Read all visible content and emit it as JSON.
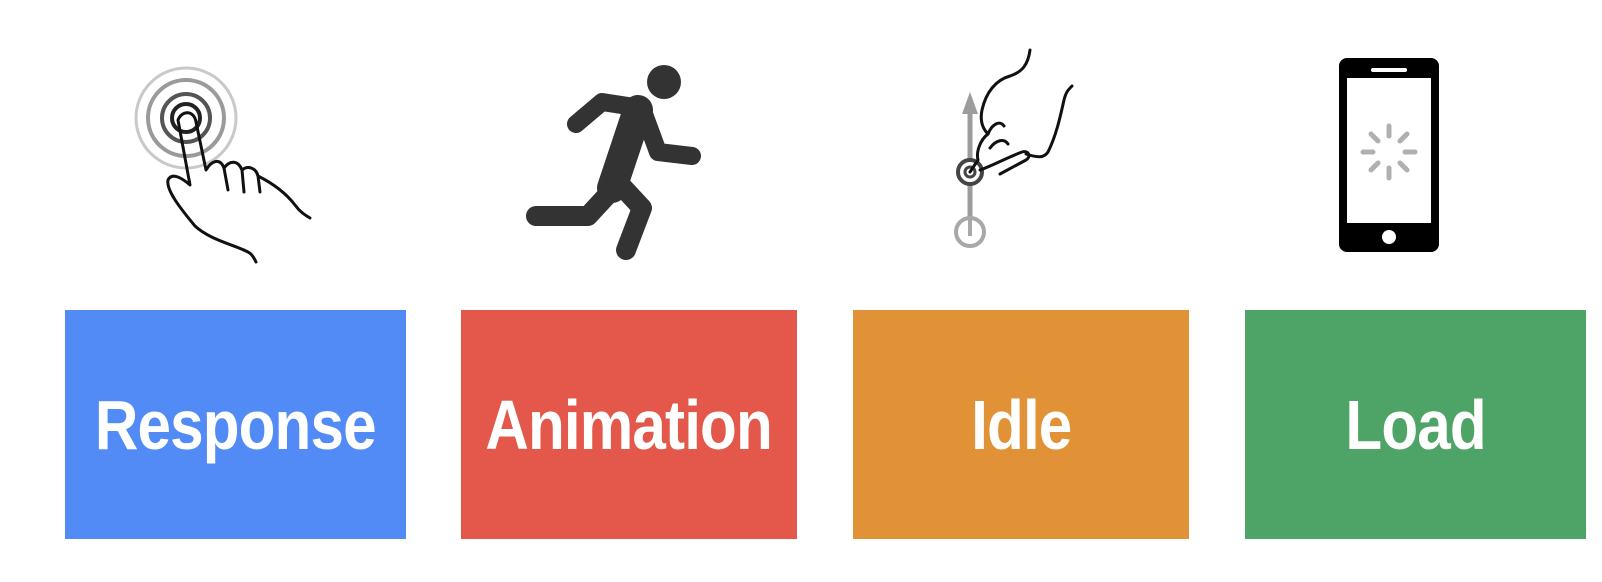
{
  "categories": [
    {
      "key": "response",
      "label": "Response",
      "color": "#528bf6",
      "icon": "tap-hand-icon"
    },
    {
      "key": "animation",
      "label": "Animation",
      "color": "#e3584a",
      "icon": "running-person-icon"
    },
    {
      "key": "idle",
      "label": "Idle",
      "color": "#e29236",
      "icon": "swipe-up-hand-icon"
    },
    {
      "key": "load",
      "label": "Load",
      "color": "#4ea466",
      "icon": "phone-loading-icon"
    }
  ]
}
